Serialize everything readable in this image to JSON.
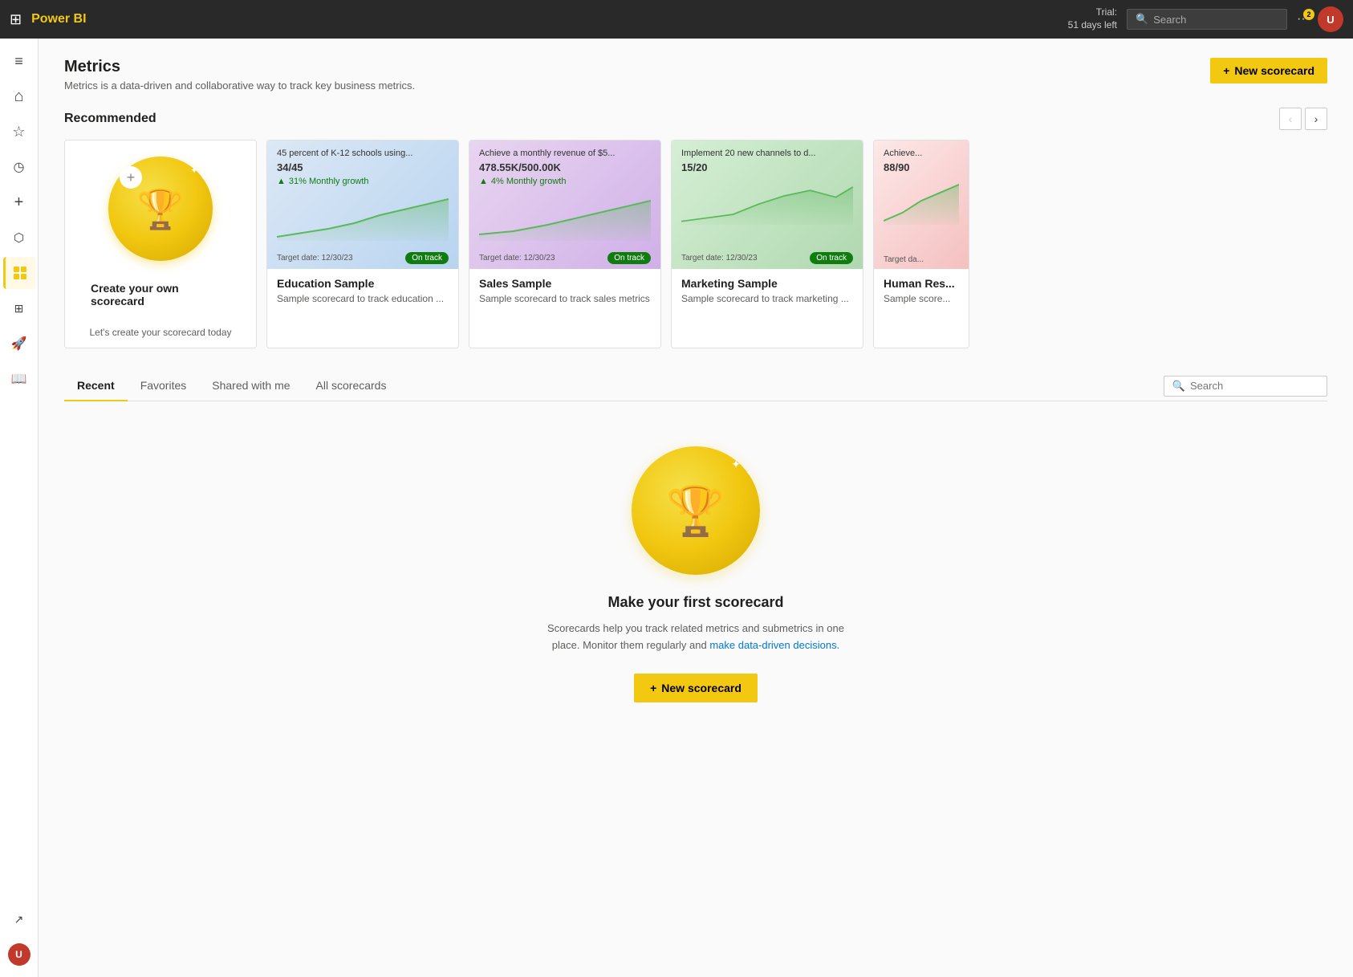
{
  "topbar": {
    "logo": "Power BI",
    "trial_line1": "Trial:",
    "trial_line2": "51 days left",
    "search_placeholder": "Search",
    "notification_count": "2",
    "avatar_initials": "U"
  },
  "sidebar": {
    "items": [
      {
        "id": "menu",
        "icon": "≡",
        "label": "Menu"
      },
      {
        "id": "home",
        "icon": "⌂",
        "label": "Home"
      },
      {
        "id": "favorites",
        "icon": "☆",
        "label": "Favorites"
      },
      {
        "id": "recent",
        "icon": "◷",
        "label": "Recent"
      },
      {
        "id": "create",
        "icon": "+",
        "label": "Create"
      },
      {
        "id": "datahub",
        "icon": "⬡",
        "label": "Data hub"
      },
      {
        "id": "metrics",
        "icon": "▦",
        "label": "Metrics",
        "active": true
      },
      {
        "id": "apps",
        "icon": "⊞",
        "label": "Apps"
      },
      {
        "id": "learn",
        "icon": "⚑",
        "label": "Learn"
      },
      {
        "id": "workbook",
        "icon": "📖",
        "label": "Workbook"
      }
    ],
    "bottom_items": [
      {
        "id": "external",
        "icon": "↗",
        "label": "External link"
      },
      {
        "id": "avatar",
        "icon": "👤",
        "label": "Account"
      }
    ]
  },
  "metrics": {
    "title": "Metrics",
    "subtitle": "Metrics is a data-driven and collaborative way to track key business metrics.",
    "new_scorecard_btn": "New scorecard",
    "recommended_title": "Recommended"
  },
  "scorecards": [
    {
      "id": "create",
      "title": "Create your own scorecard",
      "subtitle": "Let's create your scorecard today",
      "type": "create"
    },
    {
      "id": "education",
      "title": "Education Sample",
      "subtitle": "Sample scorecard to track education ...",
      "preview_text": "45 percent of K-12 schools using...",
      "counter": "34/45",
      "growth_text": "31% Monthly growth",
      "target_date": "Target date: 12/30/23",
      "status": "On track",
      "type": "education"
    },
    {
      "id": "sales",
      "title": "Sales Sample",
      "subtitle": "Sample scorecard to track sales metrics",
      "preview_text": "Achieve a monthly revenue of $5...",
      "counter": "478.55K/500.00K",
      "growth_text": "4% Monthly growth",
      "target_date": "Target date: 12/30/23",
      "status": "On track",
      "type": "sales"
    },
    {
      "id": "marketing",
      "title": "Marketing Sample",
      "subtitle": "Sample scorecard to track marketing ...",
      "preview_text": "Implement 20 new channels to d...",
      "counter": "15/20",
      "growth_text": "",
      "target_date": "Target date: 12/30/23",
      "status": "On track",
      "type": "marketing"
    },
    {
      "id": "human-resources",
      "title": "Human Res...",
      "subtitle": "Sample score...",
      "preview_text": "Achieve...",
      "counter": "88/90",
      "growth_text": "",
      "target_date": "Target da...",
      "status": "",
      "type": "hr"
    }
  ],
  "tabs": {
    "items": [
      {
        "id": "recent",
        "label": "Recent",
        "active": true
      },
      {
        "id": "favorites",
        "label": "Favorites",
        "active": false
      },
      {
        "id": "shared",
        "label": "Shared with me",
        "active": false
      },
      {
        "id": "all",
        "label": "All scorecards",
        "active": false
      }
    ],
    "search_placeholder": "Search"
  },
  "empty_state": {
    "title": "Make your first scorecard",
    "description_line1": "Scorecards help you track related metrics and submetrics in one",
    "description_line2": "place. Monitor them regularly and make data-driven decisions.",
    "new_scorecard_btn": "New scorecard"
  }
}
